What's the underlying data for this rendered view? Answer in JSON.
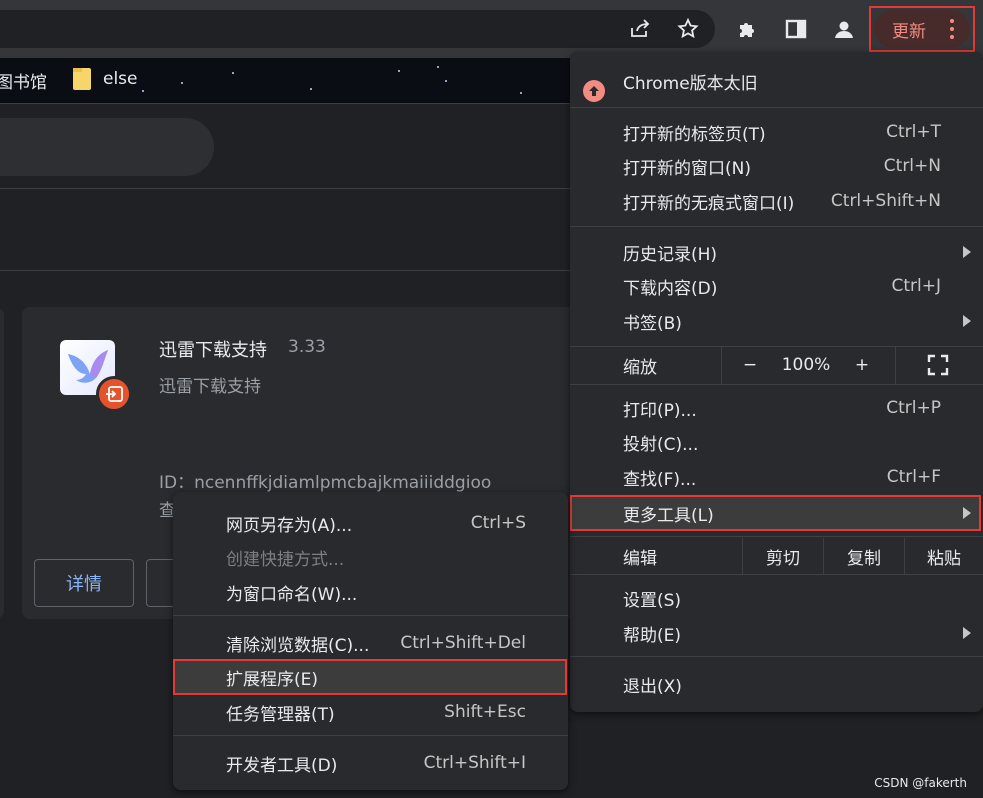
{
  "toolbar": {
    "update_label": "更新"
  },
  "bookmarks": [
    {
      "label": "图书馆"
    },
    {
      "label": "else"
    }
  ],
  "extension_card": {
    "name": "迅雷下载支持",
    "version": "3.33",
    "description": "迅雷下载支持",
    "id_text": "ID：ncennffkjdiamlpmcbajkmaiiiddgioo",
    "second_line": "查",
    "details_label": "详情"
  },
  "main_menu": {
    "update_item": "Chrome版本太旧",
    "items": [
      {
        "label": "打开新的标签页(T)",
        "shortcut": "Ctrl+T"
      },
      {
        "label": "打开新的窗口(N)",
        "shortcut": "Ctrl+N"
      },
      {
        "label": "打开新的无痕式窗口(I)",
        "shortcut": "Ctrl+Shift+N"
      },
      {
        "label": "历史记录(H)",
        "shortcut": ""
      },
      {
        "label": "下载内容(D)",
        "shortcut": "Ctrl+J"
      },
      {
        "label": "书签(B)",
        "shortcut": ""
      },
      {
        "label": "打印(P)...",
        "shortcut": "Ctrl+P"
      },
      {
        "label": "投射(C)...",
        "shortcut": ""
      },
      {
        "label": "查找(F)...",
        "shortcut": "Ctrl+F"
      },
      {
        "label": "更多工具(L)",
        "shortcut": ""
      },
      {
        "label": "设置(S)",
        "shortcut": ""
      },
      {
        "label": "帮助(E)",
        "shortcut": ""
      },
      {
        "label": "退出(X)",
        "shortcut": ""
      }
    ],
    "zoom": {
      "label": "缩放",
      "minus": "−",
      "value": "100%",
      "plus": "+"
    },
    "edit": {
      "label": "编辑",
      "cut": "剪切",
      "copy": "复制",
      "paste": "粘贴"
    }
  },
  "sub_menu": {
    "items": [
      {
        "label": "网页另存为(A)...",
        "shortcut": "Ctrl+S"
      },
      {
        "label": "创建快捷方式...",
        "shortcut": ""
      },
      {
        "label": "为窗口命名(W)...",
        "shortcut": ""
      },
      {
        "label": "清除浏览数据(C)...",
        "shortcut": "Ctrl+Shift+Del"
      },
      {
        "label": "扩展程序(E)",
        "shortcut": ""
      },
      {
        "label": "任务管理器(T)",
        "shortcut": "Shift+Esc"
      },
      {
        "label": "开发者工具(D)",
        "shortcut": "Ctrl+Shift+I"
      }
    ]
  },
  "watermark": "CSDN @fakerth",
  "colors": {
    "highlight_border": "#e53935",
    "update_text": "#f28b82",
    "link_blue": "#8ab4f8"
  }
}
